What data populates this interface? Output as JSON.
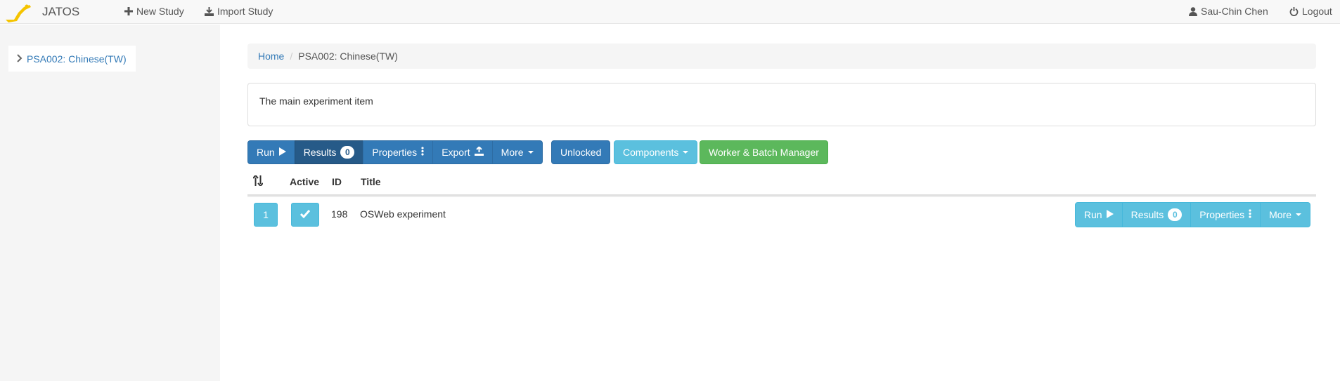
{
  "navbar": {
    "brand": "JATOS",
    "new_study": "New Study",
    "import_study": "Import Study",
    "user": "Sau-Chin Chen",
    "logout": "Logout"
  },
  "sidebar": {
    "items": [
      {
        "label": "PSA002: Chinese(TW)"
      }
    ]
  },
  "breadcrumb": {
    "home": "Home",
    "separator": "/",
    "current": "PSA002: Chinese(TW)"
  },
  "description": "The main experiment item",
  "toolbar": {
    "run": "Run",
    "results": "Results",
    "results_count": "0",
    "properties": "Properties",
    "export": "Export",
    "more": "More",
    "unlocked": "Unlocked",
    "components": "Components",
    "worker_batch": "Worker & Batch Manager"
  },
  "table": {
    "headers": {
      "active": "Active",
      "id": "ID",
      "title": "Title"
    },
    "rows": [
      {
        "position": "1",
        "id": "198",
        "title": "OSWeb experiment",
        "run": "Run",
        "results": "Results",
        "results_count": "0",
        "properties": "Properties",
        "more": "More"
      }
    ]
  },
  "colors": {
    "primary": "#337ab7",
    "primary_active": "#265a88",
    "info": "#5bc0de",
    "success": "#5cb85c",
    "logo_yellow": "#f5c400"
  }
}
